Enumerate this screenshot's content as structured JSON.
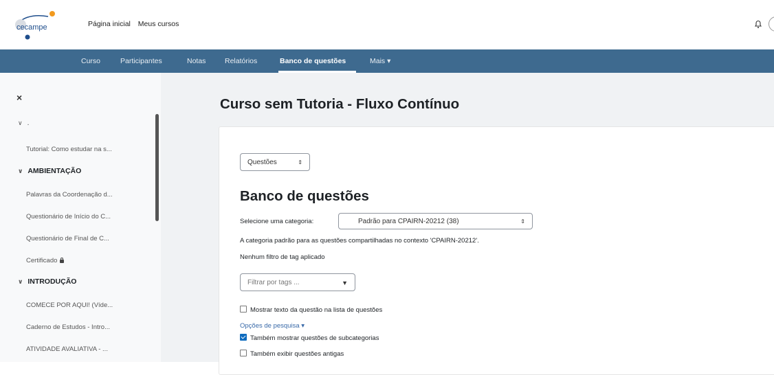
{
  "brand": {
    "logo_text": "cecampe",
    "accent": "#3e6a8f",
    "logo_orange": "#f29a1e",
    "logo_blue": "#1f4e8c"
  },
  "topnav": {
    "home": "Página inicial",
    "my_courses": "Meus cursos"
  },
  "secnav": {
    "items": [
      "Curso",
      "Participantes",
      "Notas",
      "Relatórios",
      "Banco de questões",
      "Mais ▾"
    ],
    "active": "Banco de questões"
  },
  "drawer": {
    "close": "×",
    "top_row": ".",
    "tutorial": "Tutorial: Como estudar na s...",
    "sections": [
      {
        "title": "AMBIENTAÇÃO",
        "items": [
          "Palavras da Coordenação d...",
          "Questionário de Início do C...",
          "Questionário de Final de C...",
          "Certificado"
        ]
      },
      {
        "title": "INTRODUÇÃO",
        "items": [
          "COMECE POR AQUI! (Víde...",
          "Caderno de Estudos - Intro...",
          "ATIVIDADE AVALIATIVA - ..."
        ]
      }
    ]
  },
  "main": {
    "page_title": "Curso sem Tutoria - Fluxo Contínuo",
    "top_select": "Questões",
    "heading": "Banco de questões",
    "category_label": "Selecione uma categoria:",
    "category_value": "Padrão para CPAIRN-20212 (38)",
    "category_note": "A categoria padrão para as questões compartilhadas no contexto 'CPAIRN-20212'.",
    "tag_note": "Nenhum filtro de tag aplicado",
    "tag_filter_placeholder": "Filtrar por tags ...",
    "show_text_label": "Mostrar texto da questão na lista de questões",
    "search_options": "Opções de pesquisa ▾",
    "sub_categories_label": "Também mostrar questões de subcategorias",
    "old_questions_label": "Também exibir questões antigas"
  }
}
